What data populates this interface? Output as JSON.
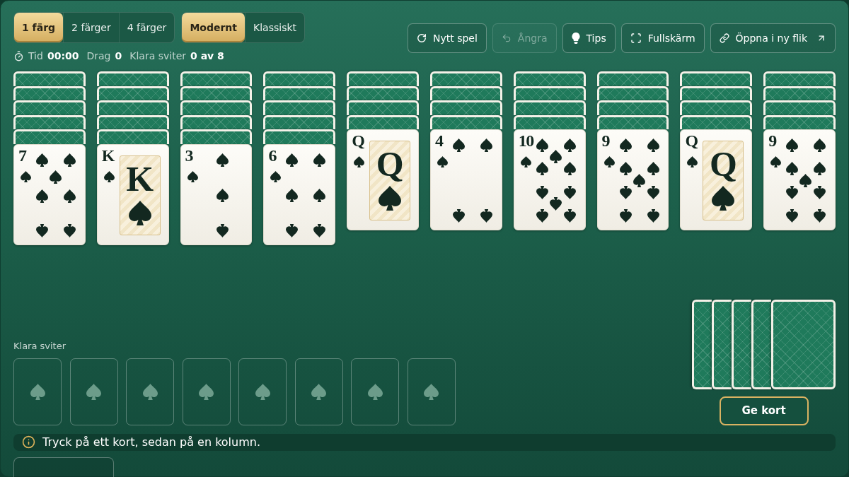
{
  "toolbar": {
    "suit_modes": [
      {
        "label": "1 färg",
        "selected": true
      },
      {
        "label": "2 färger",
        "selected": false
      },
      {
        "label": "4 färger",
        "selected": false
      }
    ],
    "styles": [
      {
        "label": "Modernt",
        "selected": true
      },
      {
        "label": "Klassiskt",
        "selected": false
      }
    ]
  },
  "stats": [
    {
      "label": "Tid",
      "value": "00:00"
    },
    {
      "label": "Drag",
      "value": "0"
    },
    {
      "label": "Klara sviter",
      "value": "0 av 8"
    }
  ],
  "actions": [
    {
      "kind": "refresh",
      "label": "Nytt spel",
      "disabled": false
    },
    {
      "kind": "undo",
      "label": "Ångra",
      "disabled": true
    },
    {
      "kind": "hint",
      "label": "Tips",
      "disabled": false
    },
    {
      "kind": "fullscreen",
      "label": "Fullskärm",
      "disabled": false
    },
    {
      "kind": "link",
      "label": "Öppna i ny flik",
      "disabled": false
    }
  ],
  "tableau": [
    {
      "cards": [
        {
          "face_up": false
        },
        {
          "face_up": false
        },
        {
          "face_up": false
        },
        {
          "face_up": false
        },
        {
          "face_up": false
        },
        {
          "face_up": true,
          "rank": "7",
          "kind": "seven"
        }
      ]
    },
    {
      "cards": [
        {
          "face_up": false
        },
        {
          "face_up": false
        },
        {
          "face_up": false
        },
        {
          "face_up": false
        },
        {
          "face_up": false
        },
        {
          "face_up": true,
          "rank": "K",
          "figure": "K",
          "kind": "face"
        }
      ]
    },
    {
      "cards": [
        {
          "face_up": false
        },
        {
          "face_up": false
        },
        {
          "face_up": false
        },
        {
          "face_up": false
        },
        {
          "face_up": false
        },
        {
          "face_up": true,
          "rank": "3",
          "kind": "three"
        }
      ]
    },
    {
      "cards": [
        {
          "face_up": false
        },
        {
          "face_up": false
        },
        {
          "face_up": false
        },
        {
          "face_up": false
        },
        {
          "face_up": false
        },
        {
          "face_up": true,
          "rank": "6",
          "kind": "six"
        }
      ]
    },
    {
      "cards": [
        {
          "face_up": false
        },
        {
          "face_up": false
        },
        {
          "face_up": false
        },
        {
          "face_up": false
        },
        {
          "face_up": true,
          "rank": "Q",
          "figure": "Q",
          "kind": "face"
        }
      ]
    },
    {
      "cards": [
        {
          "face_up": false
        },
        {
          "face_up": false
        },
        {
          "face_up": false
        },
        {
          "face_up": false
        },
        {
          "face_up": true,
          "rank": "4",
          "kind": "four"
        }
      ]
    },
    {
      "cards": [
        {
          "face_up": false
        },
        {
          "face_up": false
        },
        {
          "face_up": false
        },
        {
          "face_up": false
        },
        {
          "face_up": true,
          "rank": "10",
          "kind": "ten"
        }
      ]
    },
    {
      "cards": [
        {
          "face_up": false
        },
        {
          "face_up": false
        },
        {
          "face_up": false
        },
        {
          "face_up": false
        },
        {
          "face_up": true,
          "rank": "9",
          "kind": "nine"
        }
      ]
    },
    {
      "cards": [
        {
          "face_up": false
        },
        {
          "face_up": false
        },
        {
          "face_up": false
        },
        {
          "face_up": false
        },
        {
          "face_up": true,
          "rank": "Q",
          "figure": "Q",
          "kind": "face"
        }
      ]
    },
    {
      "cards": [
        {
          "face_up": false
        },
        {
          "face_up": false
        },
        {
          "face_up": false
        },
        {
          "face_up": false
        },
        {
          "face_up": true,
          "rank": "9",
          "kind": "nine"
        }
      ]
    }
  ],
  "foundation": {
    "label": "Klara sviter",
    "slots": [
      {
        "filled": false
      },
      {
        "filled": false
      },
      {
        "filled": false
      },
      {
        "filled": false
      },
      {
        "filled": false
      },
      {
        "filled": false
      },
      {
        "filled": false
      },
      {
        "filled": false
      }
    ]
  },
  "stock": {
    "cards": [
      {
        "face_up": false
      },
      {
        "face_up": false
      },
      {
        "face_up": false
      },
      {
        "face_up": false
      },
      {
        "face_up": false
      }
    ],
    "button": "Ge kort"
  },
  "hint": "Tryck på ett kort, sedan på en kolumn."
}
